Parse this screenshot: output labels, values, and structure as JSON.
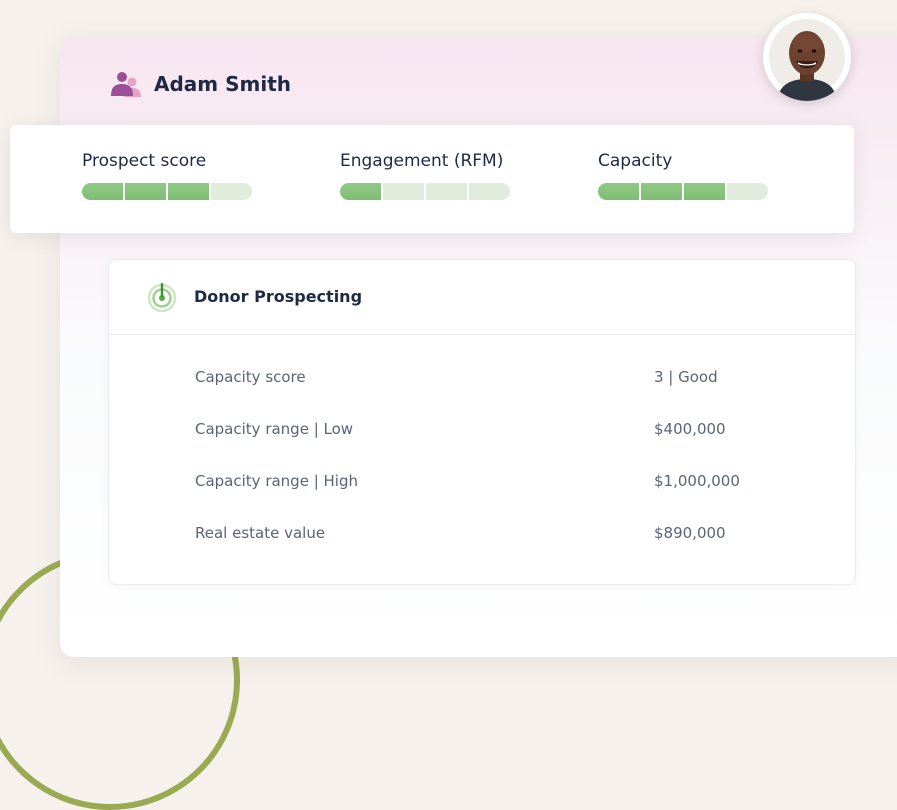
{
  "user": {
    "name": "Adam Smith"
  },
  "scores": [
    {
      "label": "Prospect score",
      "filled": 3,
      "total": 4
    },
    {
      "label": "Engagement (RFM)",
      "filled": 1,
      "total": 4
    },
    {
      "label": "Capacity",
      "filled": 3,
      "total": 4
    }
  ],
  "donor_prospecting": {
    "title": "Donor Prospecting",
    "rows": [
      {
        "label": "Capacity score",
        "value": "3 | Good"
      },
      {
        "label": "Capacity range | Low",
        "value": "$400,000"
      },
      {
        "label": "Capacity range | High",
        "value": "$1,000,000"
      },
      {
        "label": "Real estate value",
        "value": "$890,000"
      }
    ]
  },
  "colors": {
    "accent_purple": "#9b4f96",
    "accent_pink": "#e7a2c4",
    "bar_filled": "#7fbd74",
    "bar_empty": "#e0eddd",
    "text_dark": "#1e2a44",
    "text_muted": "#5a6478"
  },
  "icons": {
    "user": "users-icon",
    "donor": "target-icon"
  }
}
